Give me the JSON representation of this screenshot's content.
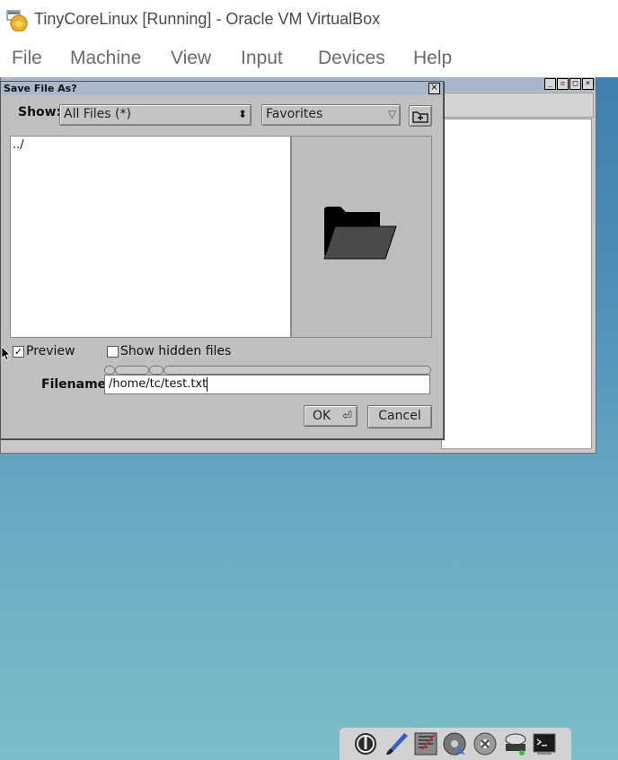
{
  "host_window": {
    "title": "TinyCoreLinux [Running] - Oracle VM VirtualBox",
    "menu": [
      "File",
      "Machine",
      "View",
      "Input",
      "Devices",
      "Help"
    ]
  },
  "dialog": {
    "title": "Save File As?",
    "show_label": "Show:",
    "filter_value": "All Files (*)",
    "favorites_value": "Favorites",
    "file_list_items": [
      "../"
    ],
    "preview_label": "Preview",
    "preview_checked": true,
    "hidden_label": "Show hidden files",
    "hidden_checked": false,
    "filename_label": "Filename:",
    "filename_value": "/home/tc/test.txt",
    "ok_label": "OK",
    "cancel_label": "Cancel"
  },
  "colors": {
    "desktop_top": "#3f7fad",
    "desktop_bottom": "#7dbec8",
    "dialog_bg": "#c0c0c0",
    "titlebar": "#a9b7cc"
  },
  "icons": {
    "preview": "folder-icon",
    "dock": [
      "power-icon",
      "paint-brush-icon",
      "editor-icon",
      "disk-icon",
      "settings-gear-icon",
      "drive-icon",
      "terminal-icon"
    ]
  }
}
